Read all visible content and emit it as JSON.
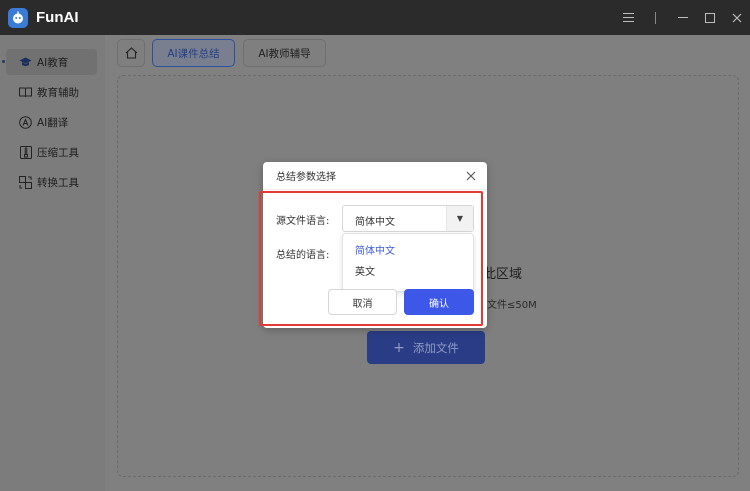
{
  "app": {
    "title": "FunAI"
  },
  "sidebar": {
    "items": [
      {
        "label": "AI教育",
        "icon": "graduation-cap-icon"
      },
      {
        "label": "教育辅助",
        "icon": "book-icon"
      },
      {
        "label": "AI翻译",
        "icon": "translate-icon"
      },
      {
        "label": "压缩工具",
        "icon": "compress-icon"
      },
      {
        "label": "转换工具",
        "icon": "convert-icon"
      }
    ]
  },
  "tabs": [
    {
      "label": "AI课件总结"
    },
    {
      "label": "AI教师辅导"
    }
  ],
  "dropzone": {
    "title": "此区域",
    "hint": "文件≤50M",
    "add_button": "添加文件"
  },
  "dialog": {
    "title": "总结参数选择",
    "source_label": "源文件语言:",
    "source_value": "简体中文",
    "target_label": "总结的语言:",
    "options": [
      "简体中文",
      "英文"
    ],
    "cancel_label": "取消",
    "confirm_label": "确认"
  },
  "colors": {
    "accent": "#3d57e8",
    "highlight": "#e53935"
  }
}
